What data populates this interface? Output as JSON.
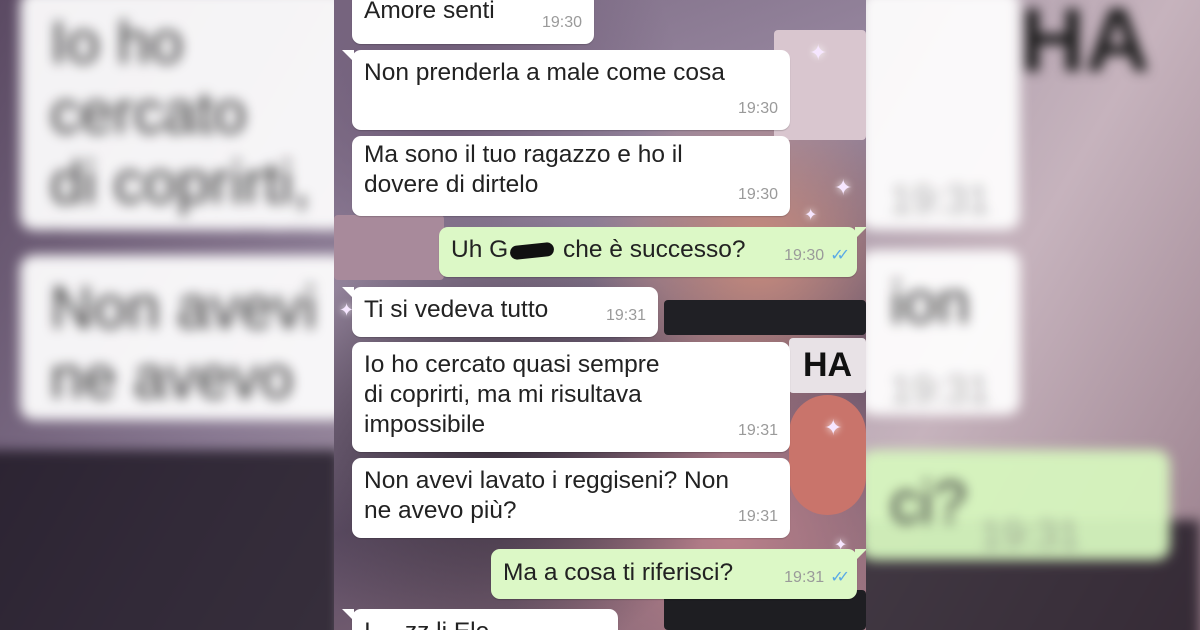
{
  "messages": [
    {
      "direction": "in",
      "text": "Amore senti",
      "time": "19:30"
    },
    {
      "direction": "in",
      "text": "Non prenderla a male come cosa",
      "time": "19:30"
    },
    {
      "direction": "in",
      "text": "Ma sono il tuo ragazzo e ho il\ndovere di dirtelo",
      "time": "19:30"
    },
    {
      "direction": "out",
      "text_before": "Uh G",
      "text_after": " che è successo?",
      "time": "19:30",
      "status": "read"
    },
    {
      "direction": "in",
      "text": "Ti si vedeva tutto",
      "time": "19:31"
    },
    {
      "direction": "in",
      "text": "Io ho cercato quasi sempre\ndi coprirti, ma mi risultava\nimpossibile",
      "time": "19:31"
    },
    {
      "direction": "in",
      "text": "Non avevi lavato i reggiseni? Non\nne avevo più?",
      "time": "19:31"
    },
    {
      "direction": "out",
      "text": "Ma a cosa ti riferisci?",
      "time": "19:31",
      "status": "read"
    },
    {
      "direction": "in",
      "text": "I ....zz li Ele",
      "time": ""
    }
  ],
  "background_text": {
    "left_1": "Io ho cercato\ndi coprirti,\nimpossibil",
    "left_2": "Non avevi\nne avevo p",
    "right_time_1": "19:31",
    "right_time_2": "19:31",
    "right_1": "ion",
    "right_2": "ci?",
    "right_time_3": "19:31",
    "right_logo": "HA"
  },
  "wallpaper_text": {
    "logo": "HA"
  },
  "colors": {
    "incoming_bubble": "#ffffff",
    "outgoing_bubble": "#dcf8c6",
    "timestamp": "#9a9a9a",
    "read_ticks": "#5aa9e6"
  },
  "icons": {
    "read_receipt": "double-check-icon",
    "sparkle": "sparkle-icon"
  }
}
